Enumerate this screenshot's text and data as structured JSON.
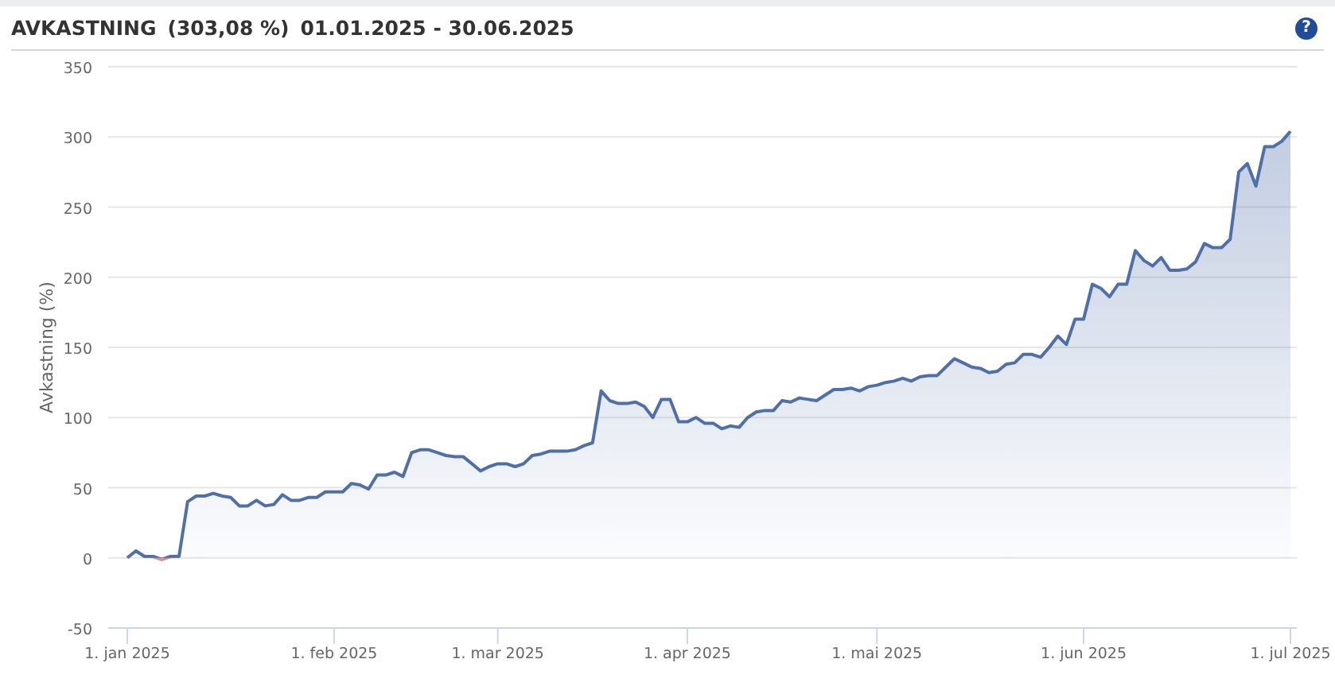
{
  "header": {
    "title": "AVKASTNING",
    "return": "(303,08 %)",
    "period": "01.01.2025 - 30.06.2025",
    "help": "?"
  },
  "chart_data": {
    "type": "area",
    "grid": true,
    "ylabel": "Avkastning (%)",
    "ylim": [
      -50,
      350
    ],
    "yticks": [
      -50,
      0,
      50,
      100,
      150,
      200,
      250,
      300,
      350
    ],
    "categories": [
      "1. jan 2025",
      null,
      null,
      null,
      null,
      null,
      null,
      null,
      null,
      null,
      null,
      null,
      null,
      null,
      null,
      null,
      null,
      null,
      null,
      null,
      null,
      null,
      null,
      null,
      "1. feb 2025",
      null,
      null,
      null,
      null,
      null,
      null,
      null,
      null,
      null,
      null,
      null,
      null,
      null,
      null,
      null,
      null,
      null,
      null,
      "1. mar 2025",
      null,
      null,
      null,
      null,
      null,
      null,
      null,
      null,
      null,
      null,
      null,
      null,
      null,
      null,
      null,
      null,
      null,
      null,
      null,
      null,
      null,
      "1. apr 2025",
      null,
      null,
      null,
      null,
      null,
      null,
      null,
      null,
      null,
      null,
      null,
      null,
      null,
      null,
      null,
      null,
      null,
      null,
      null,
      null,
      null,
      "1. mai 2025",
      null,
      null,
      null,
      null,
      null,
      null,
      null,
      null,
      null,
      null,
      null,
      null,
      null,
      null,
      null,
      null,
      null,
      null,
      null,
      null,
      null,
      null,
      null,
      "1. jun 2025",
      null,
      null,
      null,
      null,
      null,
      null,
      null,
      null,
      null,
      null,
      null,
      null,
      null,
      null,
      null,
      null,
      null,
      null,
      null,
      null,
      null,
      null,
      null,
      "1. jul 2025"
    ],
    "series": [
      {
        "color": "#4f6fa8",
        "values": [
          0,
          5,
          1,
          1,
          -1,
          1,
          1,
          40,
          44,
          44,
          46,
          44,
          43,
          37,
          37,
          41,
          37,
          38,
          45,
          41,
          41,
          43,
          43,
          47,
          47,
          47,
          53,
          52,
          49,
          59,
          59,
          61,
          58,
          75,
          77,
          77,
          75,
          73,
          72,
          72,
          67,
          62,
          65,
          67,
          67,
          65,
          67,
          73,
          74,
          76,
          76,
          76,
          77,
          80,
          82,
          119,
          112,
          110,
          110,
          111,
          108,
          100,
          113,
          113,
          97,
          97,
          100,
          96,
          96,
          92,
          94,
          93,
          100,
          104,
          105,
          105,
          112,
          111,
          114,
          113,
          112,
          116,
          120,
          120,
          121,
          119,
          122,
          123,
          125,
          126,
          128,
          126,
          129,
          130,
          130,
          136,
          142,
          139,
          136,
          135,
          132,
          133,
          138,
          139,
          145,
          145,
          143,
          150,
          158,
          152,
          170,
          170,
          195,
          192,
          186,
          195,
          195,
          219,
          212,
          208,
          214,
          205,
          205,
          206,
          211,
          224,
          221,
          221,
          227,
          275,
          281,
          265,
          293,
          293,
          297,
          304
        ]
      }
    ]
  }
}
